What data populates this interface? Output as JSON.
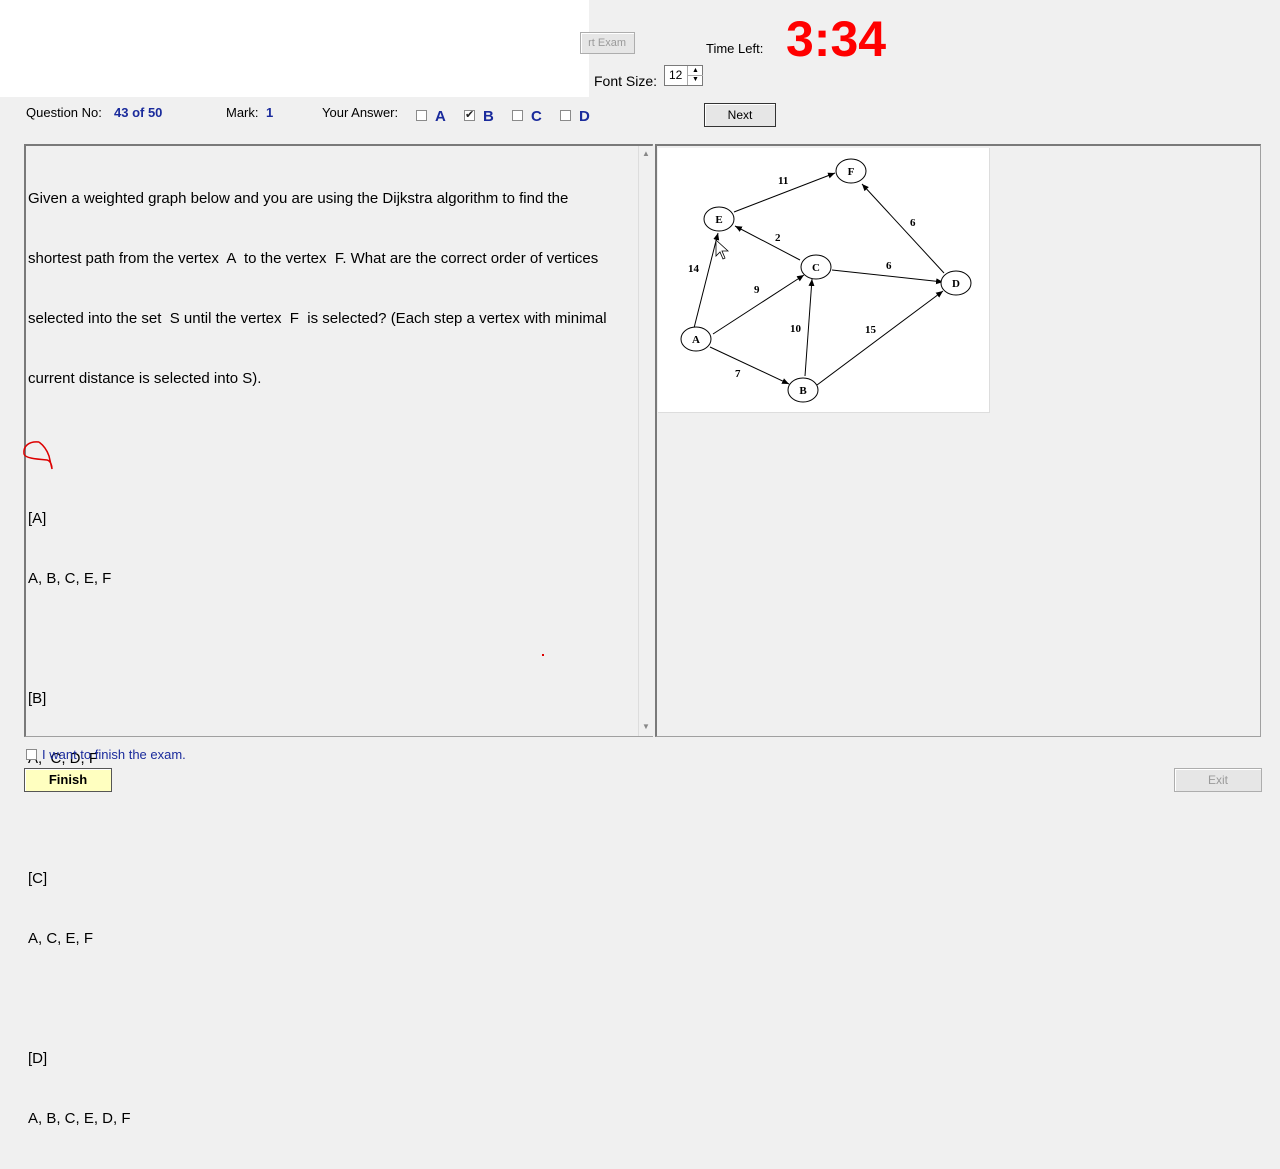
{
  "header": {
    "exit_exam_partial": "rt Exam",
    "time_left_label": "Time Left:",
    "time_left_value": "3:34",
    "font_size_label": "Font Size:",
    "font_size_value": "12"
  },
  "question_bar": {
    "question_no_label": "Question No:",
    "question_no_value": "43 of 50",
    "mark_label": "Mark:",
    "mark_value": "1",
    "your_answer_label": "Your Answer:",
    "answers": [
      {
        "letter": "A",
        "checked": false
      },
      {
        "letter": "B",
        "checked": true
      },
      {
        "letter": "C",
        "checked": false
      },
      {
        "letter": "D",
        "checked": false
      }
    ],
    "next_label": "Next"
  },
  "question": {
    "lines": [
      "Given a weighted graph below and you are using the Dijkstra algorithm to find the",
      "shortest path from the vertex  A  to the vertex  F. What are the correct order of vertices",
      "selected into the set  S until the vertex  F  is selected? (Each step a vertex with minimal",
      "current distance is selected into S)."
    ],
    "options": [
      {
        "tag": "[A]",
        "text": "A, B, C, E, F"
      },
      {
        "tag": "[B]",
        "text": "A,  C, D, F"
      },
      {
        "tag": "[C]",
        "text": "A, C, E, F"
      },
      {
        "tag": "[D]",
        "text": "A, B, C, E, D, F"
      }
    ]
  },
  "graph": {
    "nodes": [
      "A",
      "B",
      "C",
      "D",
      "E",
      "F"
    ],
    "edges": [
      {
        "from": "A",
        "to": "E",
        "weight": "14"
      },
      {
        "from": "A",
        "to": "C",
        "weight": "9"
      },
      {
        "from": "A",
        "to": "B",
        "weight": "7"
      },
      {
        "from": "B",
        "to": "C",
        "weight": "10"
      },
      {
        "from": "B",
        "to": "D",
        "weight": "15"
      },
      {
        "from": "C",
        "to": "E",
        "weight": "2"
      },
      {
        "from": "C",
        "to": "D",
        "weight": "6"
      },
      {
        "from": "E",
        "to": "F",
        "weight": "11"
      },
      {
        "from": "D",
        "to": "F",
        "weight": "6"
      }
    ]
  },
  "footer": {
    "finish_checkbox_label": "I want to finish the exam.",
    "finish_label": "Finish",
    "exit_label": "Exit"
  },
  "colors": {
    "timer": "#ff0000",
    "accent_blue": "#1a2b9c",
    "finish_button_bg": "#ffffc0",
    "annotation": "#dd0000"
  }
}
